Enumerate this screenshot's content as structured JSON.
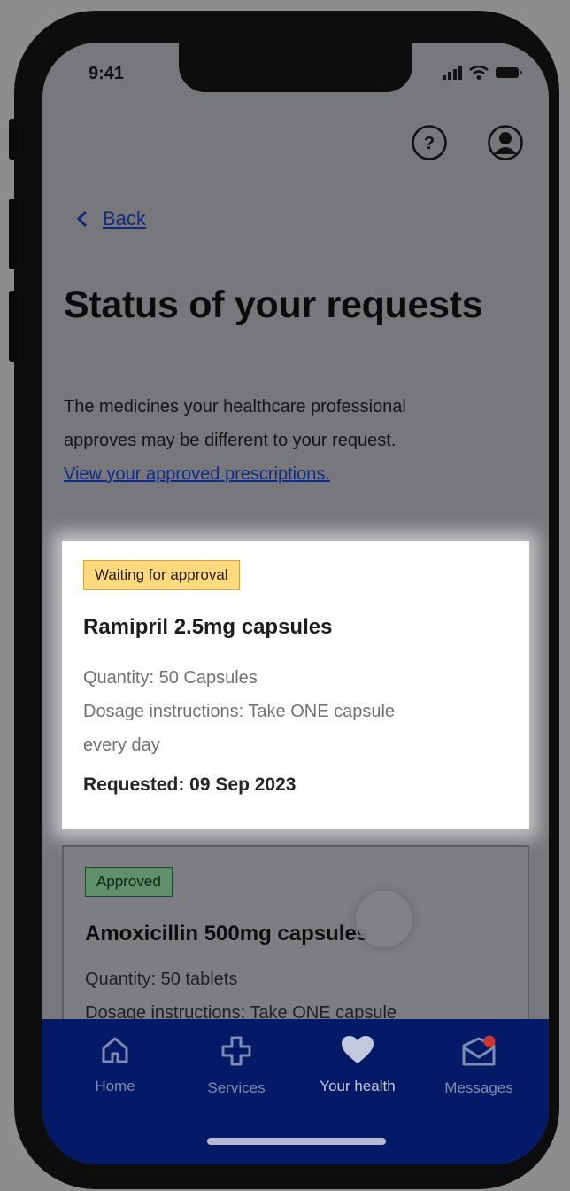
{
  "status_bar": {
    "time": "9:41"
  },
  "header": {
    "help_icon": "help-circle-icon",
    "profile_icon": "account-circle-icon"
  },
  "nav": {
    "back_label": "Back"
  },
  "page": {
    "title": "Status of your requests",
    "intro_line1": "The medicines your healthcare professional",
    "intro_line2": "approves may be different to your request.",
    "intro_link": "View your approved prescriptions."
  },
  "requests": [
    {
      "status": "Waiting for approval",
      "name": "Ramipril 2.5mg capsules",
      "quantity": "Quantity: 50 Capsules",
      "dosage_line1": "Dosage instructions: Take ONE capsule",
      "dosage_line2": "every day",
      "requested": "Requested: 09 Sep 2023"
    },
    {
      "status": "Approved",
      "name": "Amoxicillin 500mg capsules",
      "quantity": "Quantity: 50 tablets",
      "dosage_line1": "Dosage instructions: Take ONE capsule"
    }
  ],
  "tabbar": {
    "items": [
      {
        "label": "Home",
        "icon": "home-icon"
      },
      {
        "label": "Services",
        "icon": "plus-cross-icon"
      },
      {
        "label": "Your health",
        "icon": "heart-icon"
      },
      {
        "label": "Messages",
        "icon": "envelope-notification-icon"
      }
    ],
    "active_index": 2
  },
  "colors": {
    "tabbar_bg": "#041a66",
    "link": "#0f2a88",
    "waiting_tag": "#ffd97e",
    "approved_tag": "#5f8f6b",
    "notification_dot": "#d0342c"
  }
}
